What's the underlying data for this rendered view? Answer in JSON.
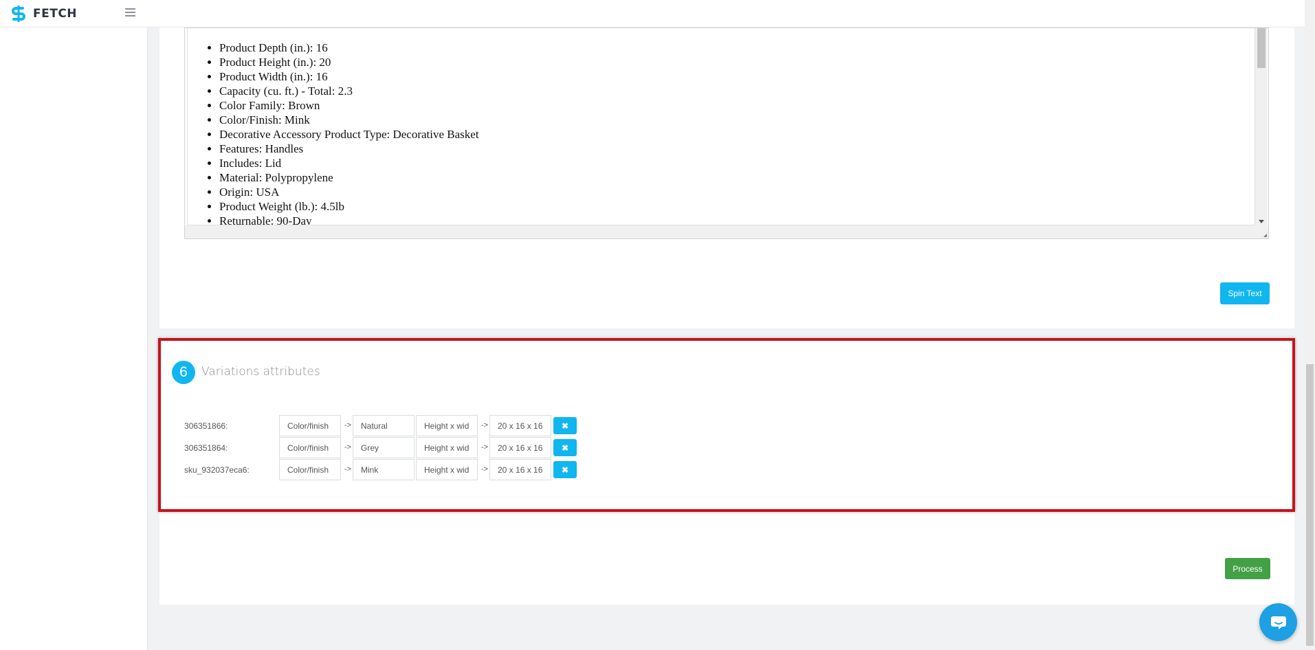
{
  "app": {
    "name": "FETCH",
    "brand_color": "#10b6f0"
  },
  "icons": {
    "menu": "hamburger-menu-icon",
    "remove": "close-x-icon",
    "chat": "chat-bubble-icon"
  },
  "description": {
    "items": [
      "Product Depth (in.): 16",
      "Product Height (in.): 20",
      "Product Width (in.): 16",
      "Capacity (cu. ft.) - Total: 2.3",
      "Color Family: Brown",
      "Color/Finish: Mink",
      "Decorative Accessory Product Type: Decorative Basket",
      "Features: Handles",
      "Includes: Lid",
      "Material: Polypropylene",
      "Origin: USA",
      "Product Weight (lb.): 4.5lb",
      "Returnable: 90-Day"
    ]
  },
  "buttons": {
    "spin_text": "Spin Text",
    "process": "Process"
  },
  "variations": {
    "step_number": "6",
    "title": "Variations attributes",
    "arrow": "->",
    "rows": [
      {
        "sku": "306351866:",
        "attr1": "Color/finish",
        "val1": "Natural",
        "attr2": "Height x wid",
        "val2": "20  x 16  x 16"
      },
      {
        "sku": "306351864:",
        "attr1": "Color/finish",
        "val1": "Grey",
        "attr2": "Height x wid",
        "val2": "20  x 16  x 16"
      },
      {
        "sku": "sku_932037eca6:",
        "attr1": "Color/finish",
        "val1": "Mink",
        "attr2": "Height x wid",
        "val2": "20  x 16  x 16"
      }
    ]
  }
}
